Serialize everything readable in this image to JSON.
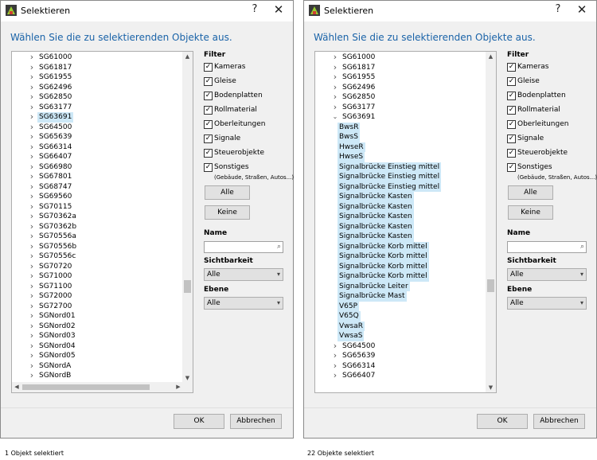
{
  "dialog_title": "Selektieren",
  "help_glyph": "?",
  "close_glyph": "✕",
  "instruction": "Wählen Sie die zu selektierenden Objekte aus.",
  "filter": {
    "heading": "Filter",
    "items": [
      {
        "label": "Kameras",
        "checked": true
      },
      {
        "label": "Gleise",
        "checked": true
      },
      {
        "label": "Bodenplatten",
        "checked": true
      },
      {
        "label": "Rollmaterial",
        "checked": true
      },
      {
        "label": "Oberleitungen",
        "checked": true
      },
      {
        "label": "Signale",
        "checked": true
      },
      {
        "label": "Steuerobjekte",
        "checked": true
      },
      {
        "label": "Sonstiges",
        "checked": true
      }
    ],
    "sonstiges_note": "(Gebäude, Straßen, Autos...)",
    "all_button": "Alle",
    "none_button": "Keine"
  },
  "name": {
    "heading": "Name",
    "value": "",
    "search_icon": "search-icon"
  },
  "visibility": {
    "heading": "Sichtbarkeit",
    "value": "Alle"
  },
  "layer": {
    "heading": "Ebene",
    "value": "Alle"
  },
  "ok_button": "OK",
  "cancel_button": "Abbrechen",
  "left": {
    "tree": [
      {
        "label": "SG61000"
      },
      {
        "label": "SG61817"
      },
      {
        "label": "SG61955"
      },
      {
        "label": "SG62496"
      },
      {
        "label": "SG62850"
      },
      {
        "label": "SG63177"
      },
      {
        "label": "SG63691",
        "selected": true
      },
      {
        "label": "SG64500"
      },
      {
        "label": "SG65639"
      },
      {
        "label": "SG66314"
      },
      {
        "label": "SG66407"
      },
      {
        "label": "SG66980"
      },
      {
        "label": "SG67801"
      },
      {
        "label": "SG68747"
      },
      {
        "label": "SG69560"
      },
      {
        "label": "SG70115"
      },
      {
        "label": "SG70362a"
      },
      {
        "label": "SG70362b"
      },
      {
        "label": "SG70556a"
      },
      {
        "label": "SG70556b"
      },
      {
        "label": "SG70556c"
      },
      {
        "label": "SG70720"
      },
      {
        "label": "SG71000"
      },
      {
        "label": "SG71100"
      },
      {
        "label": "SG72000"
      },
      {
        "label": "SG72700"
      },
      {
        "label": "SGNord01"
      },
      {
        "label": "SGNord02"
      },
      {
        "label": "SGNord03"
      },
      {
        "label": "SGNord04"
      },
      {
        "label": "SGNord05"
      },
      {
        "label": "SGNordA"
      },
      {
        "label": "SGNordB"
      }
    ],
    "status": "1 Objekt selektiert"
  },
  "right": {
    "tree": [
      {
        "label": "SG61000"
      },
      {
        "label": "SG61817"
      },
      {
        "label": "SG61955"
      },
      {
        "label": "SG62496"
      },
      {
        "label": "SG62850"
      },
      {
        "label": "SG63177"
      },
      {
        "label": "SG63691",
        "expanded": true
      },
      {
        "label": "BwsR",
        "child": true,
        "selected": true
      },
      {
        "label": "BwsS",
        "child": true,
        "selected": true
      },
      {
        "label": "HwseR",
        "child": true,
        "selected": true
      },
      {
        "label": "HwseS",
        "child": true,
        "selected": true
      },
      {
        "label": "Signalbrücke Einstieg mittel",
        "child": true,
        "selected": true
      },
      {
        "label": "Signalbrücke Einstieg mittel",
        "child": true,
        "selected": true
      },
      {
        "label": "Signalbrücke Einstieg mittel",
        "child": true,
        "selected": true
      },
      {
        "label": "Signalbrücke Kasten",
        "child": true,
        "selected": true
      },
      {
        "label": "Signalbrücke Kasten",
        "child": true,
        "selected": true
      },
      {
        "label": "Signalbrücke Kasten",
        "child": true,
        "selected": true
      },
      {
        "label": "Signalbrücke Kasten",
        "child": true,
        "selected": true
      },
      {
        "label": "Signalbrücke Kasten",
        "child": true,
        "selected": true
      },
      {
        "label": "Signalbrücke Korb mittel",
        "child": true,
        "selected": true
      },
      {
        "label": "Signalbrücke Korb mittel",
        "child": true,
        "selected": true
      },
      {
        "label": "Signalbrücke Korb mittel",
        "child": true,
        "selected": true
      },
      {
        "label": "Signalbrücke Korb mittel",
        "child": true,
        "selected": true
      },
      {
        "label": "Signalbrücke Leiter",
        "child": true,
        "selected": true
      },
      {
        "label": "Signalbrücke Mast",
        "child": true,
        "selected": true
      },
      {
        "label": "V65P",
        "child": true,
        "selected": true
      },
      {
        "label": "V65Q",
        "child": true,
        "selected": true
      },
      {
        "label": "VwsaR",
        "child": true,
        "selected": true
      },
      {
        "label": "VwsaS",
        "child": true,
        "selected": true
      },
      {
        "label": "SG64500"
      },
      {
        "label": "SG65639"
      },
      {
        "label": "SG66314"
      },
      {
        "label": "SG66407"
      }
    ],
    "status": "22 Objekte selektiert"
  }
}
